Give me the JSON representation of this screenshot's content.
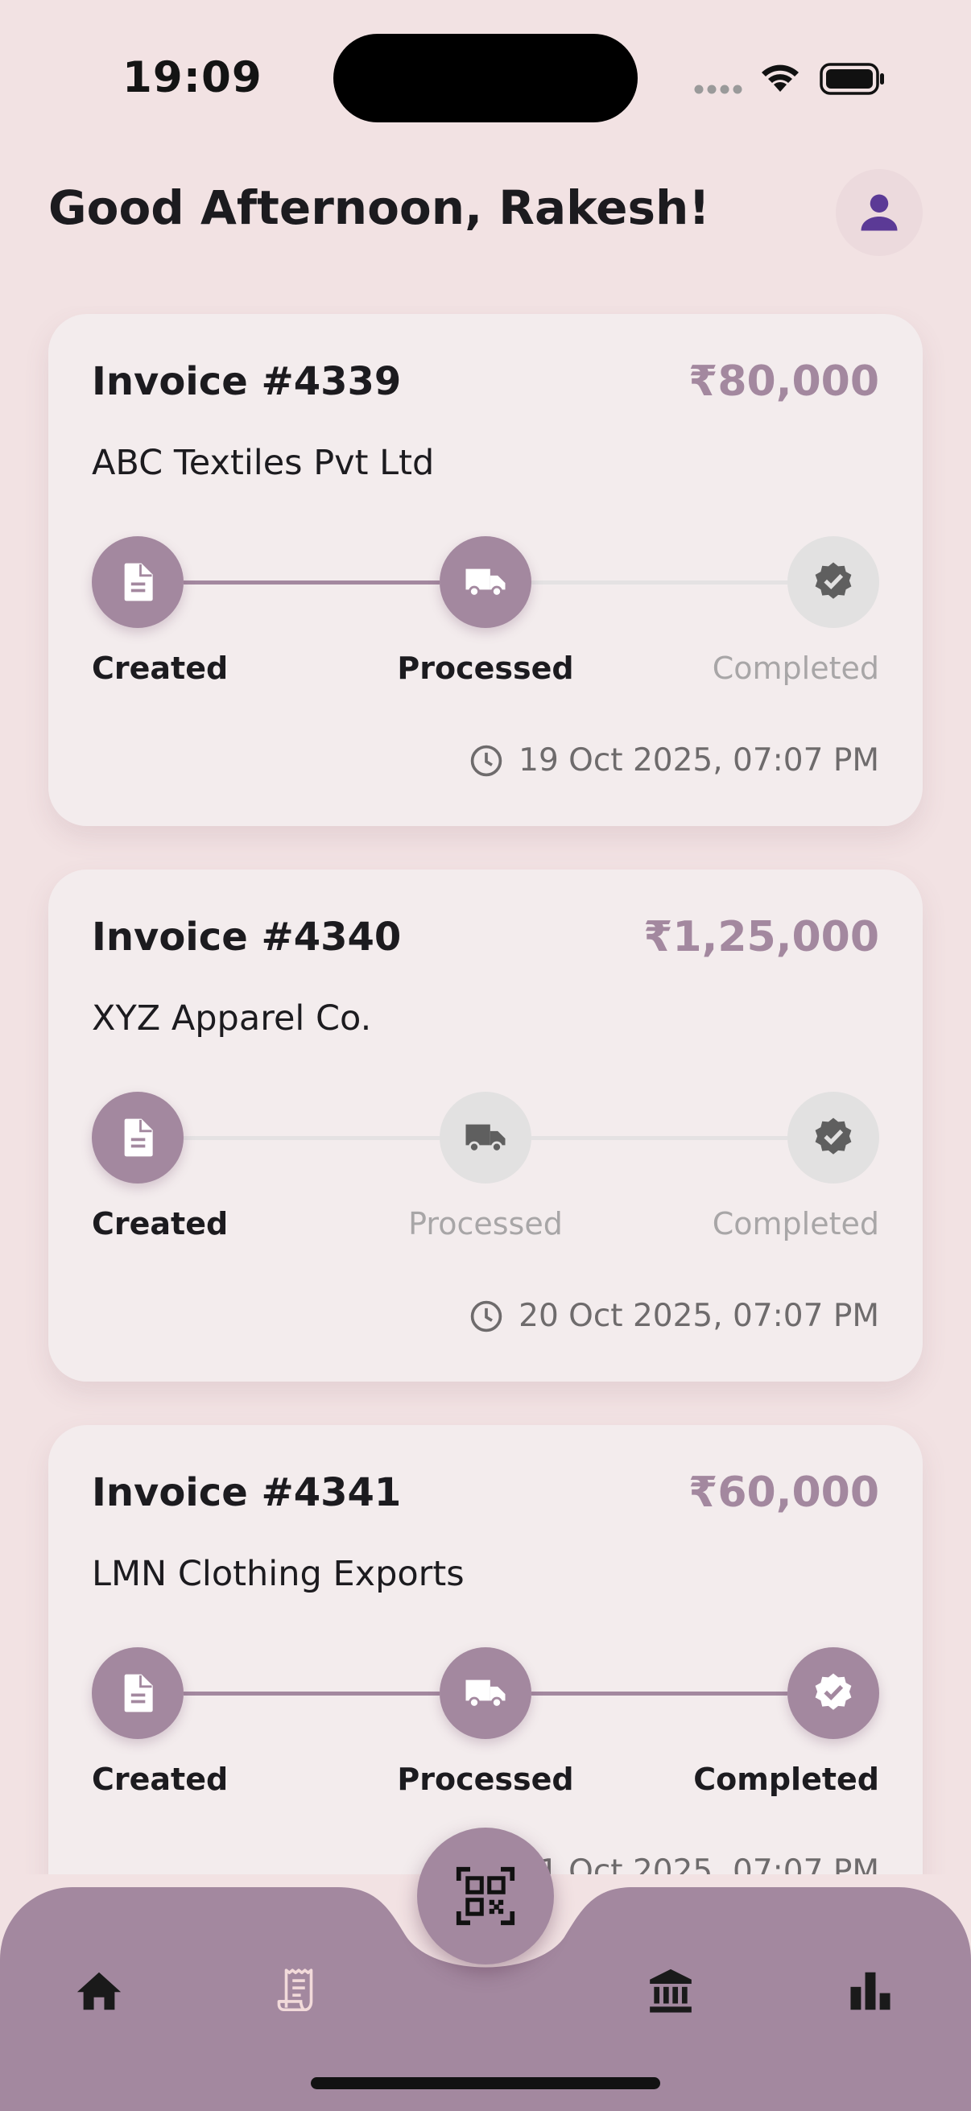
{
  "status_bar": {
    "time": "19:09"
  },
  "header": {
    "greeting": "Good Afternoon, Rakesh!",
    "avatar_icon": "person-icon"
  },
  "invoices": [
    {
      "title": "Invoice #4339",
      "amount": "₹80,000",
      "customer": "ABC Textiles Pvt Ltd",
      "steps": [
        {
          "label": "Created",
          "icon": "document-icon",
          "done": true
        },
        {
          "label": "Processed",
          "icon": "truck-icon",
          "done": true
        },
        {
          "label": "Completed",
          "icon": "verified-badge-icon",
          "done": false
        }
      ],
      "date": "19 Oct 2025, 07:07 PM"
    },
    {
      "title": "Invoice #4340",
      "amount": "₹1,25,000",
      "customer": "XYZ Apparel Co.",
      "steps": [
        {
          "label": "Created",
          "icon": "document-icon",
          "done": true
        },
        {
          "label": "Processed",
          "icon": "truck-icon",
          "done": false
        },
        {
          "label": "Completed",
          "icon": "verified-badge-icon",
          "done": false
        }
      ],
      "date": "20 Oct 2025, 07:07 PM"
    },
    {
      "title": "Invoice #4341",
      "amount": "₹60,000",
      "customer": "LMN Clothing Exports",
      "steps": [
        {
          "label": "Created",
          "icon": "document-icon",
          "done": true
        },
        {
          "label": "Processed",
          "icon": "truck-icon",
          "done": true
        },
        {
          "label": "Completed",
          "icon": "verified-badge-icon",
          "done": true
        }
      ],
      "date": "21 Oct 2025, 07:07 PM"
    }
  ],
  "bottom_nav": {
    "items": [
      "home-icon",
      "receipt-icon",
      "qr-scan-icon",
      "bank-icon",
      "bar-chart-icon"
    ]
  },
  "colors": {
    "background": "#f2e2e3",
    "accent": "#a3889f",
    "card": "#f3eced",
    "inactive": "#e2e1e1",
    "avatar_icon": "#5b3a96"
  }
}
